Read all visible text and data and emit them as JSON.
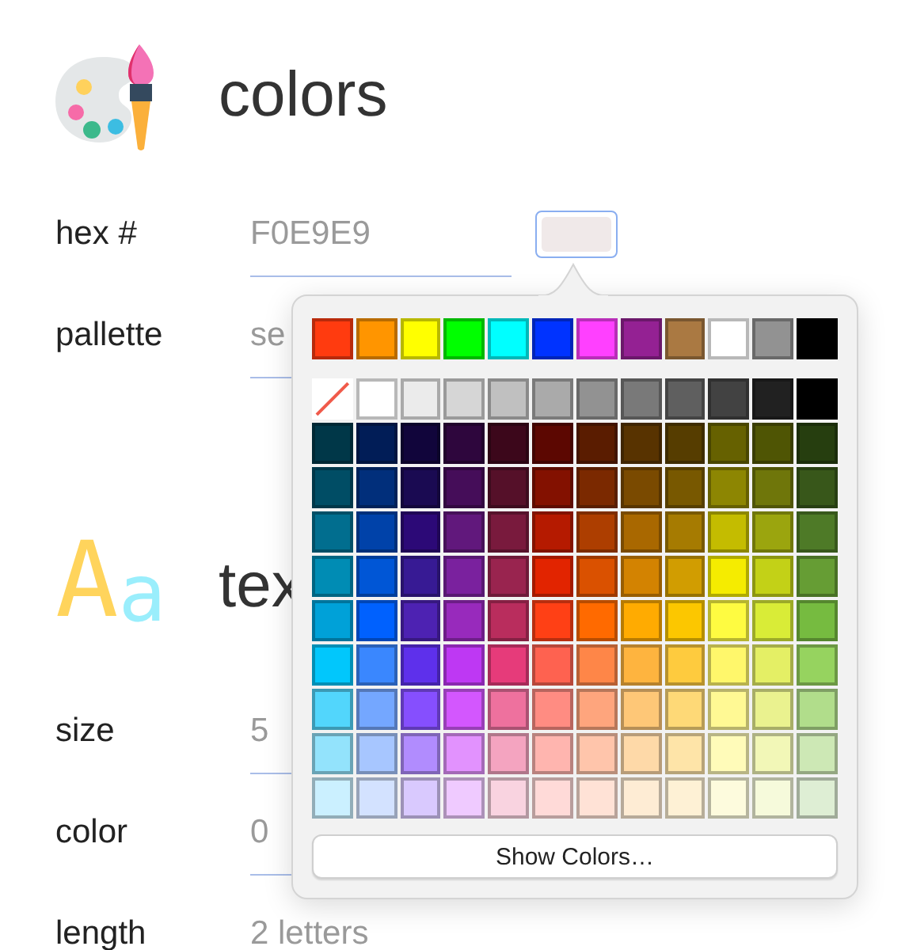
{
  "sections": [
    {
      "kind": "palette",
      "title": "colors",
      "fields": [
        {
          "label": "hex #",
          "value": "F0E9E9",
          "color_well": {
            "color": "#f0e9e9",
            "selected": true
          }
        },
        {
          "label": "pallette",
          "value": "se"
        }
      ]
    },
    {
      "kind": "letters",
      "title": "tex",
      "glyphs": [
        {
          "char": "A",
          "color": "#ffd45c"
        },
        {
          "char": "a",
          "color": "#9aeefc"
        }
      ],
      "fields": [
        {
          "label": "size",
          "value": "5"
        },
        {
          "label": "color",
          "value": "0"
        },
        {
          "label": "length",
          "value": "2 letters"
        }
      ]
    }
  ],
  "popover": {
    "top_colors": [
      {
        "color": "#ff3b0f"
      },
      {
        "color": "#ff9500"
      },
      {
        "color": "#ffff00"
      },
      {
        "color": "#00ff00"
      },
      {
        "color": "#00ffff"
      },
      {
        "color": "#0033ff"
      },
      {
        "color": "#ff40ff"
      },
      {
        "color": "#942193"
      },
      {
        "color": "#aa7942"
      },
      {
        "color": "#ffffff"
      },
      {
        "color": "#929292"
      },
      {
        "color": "#000000"
      }
    ],
    "gray_row": [
      {
        "kind": "none"
      },
      {
        "kind": "swatch",
        "color": "#ffffff"
      },
      {
        "kind": "swatch",
        "color": "#ebebeb"
      },
      {
        "kind": "swatch",
        "color": "#d6d6d6"
      },
      {
        "kind": "swatch",
        "color": "#c0c0c0"
      },
      {
        "kind": "swatch",
        "color": "#aaaaaa"
      },
      {
        "kind": "swatch",
        "color": "#929292"
      },
      {
        "kind": "swatch",
        "color": "#797979"
      },
      {
        "kind": "swatch",
        "color": "#5f5f5f"
      },
      {
        "kind": "swatch",
        "color": "#424242"
      },
      {
        "kind": "swatch",
        "color": "#212121"
      },
      {
        "kind": "swatch",
        "color": "#000000"
      }
    ],
    "grid": [
      {
        "swatches": [
          {
            "color": "#003748"
          },
          {
            "color": "#011d57"
          },
          {
            "color": "#11053b"
          },
          {
            "color": "#2e063d"
          },
          {
            "color": "#3c071b"
          },
          {
            "color": "#5c0701"
          },
          {
            "color": "#5a1c00"
          },
          {
            "color": "#583300"
          },
          {
            "color": "#563d00"
          },
          {
            "color": "#666100"
          },
          {
            "color": "#4f5504"
          },
          {
            "color": "#263e0f"
          }
        ]
      },
      {
        "swatches": [
          {
            "color": "#004d65"
          },
          {
            "color": "#012f7b"
          },
          {
            "color": "#1a0a52"
          },
          {
            "color": "#450d59"
          },
          {
            "color": "#551029"
          },
          {
            "color": "#831100"
          },
          {
            "color": "#7b2900"
          },
          {
            "color": "#7a4a00"
          },
          {
            "color": "#785800"
          },
          {
            "color": "#8d8602"
          },
          {
            "color": "#6f760a"
          },
          {
            "color": "#38571a"
          }
        ]
      },
      {
        "swatches": [
          {
            "color": "#016e8f"
          },
          {
            "color": "#0042a9"
          },
          {
            "color": "#2c0977"
          },
          {
            "color": "#61187c"
          },
          {
            "color": "#791a3d"
          },
          {
            "color": "#b51a00"
          },
          {
            "color": "#ad3e00"
          },
          {
            "color": "#a96800"
          },
          {
            "color": "#a67b01"
          },
          {
            "color": "#c4bc00"
          },
          {
            "color": "#9ba50e"
          },
          {
            "color": "#4e7a27"
          }
        ]
      },
      {
        "swatches": [
          {
            "color": "#008cb4"
          },
          {
            "color": "#0056d6"
          },
          {
            "color": "#371a94"
          },
          {
            "color": "#7a219e"
          },
          {
            "color": "#99244f"
          },
          {
            "color": "#e22400"
          },
          {
            "color": "#da5100"
          },
          {
            "color": "#d38301"
          },
          {
            "color": "#d19d01"
          },
          {
            "color": "#f5ec00"
          },
          {
            "color": "#c3d117"
          },
          {
            "color": "#669d34"
          }
        ]
      },
      {
        "swatches": [
          {
            "color": "#00a1d8"
          },
          {
            "color": "#0061fe"
          },
          {
            "color": "#4d22b2"
          },
          {
            "color": "#982abc"
          },
          {
            "color": "#b92d5d"
          },
          {
            "color": "#ff4015"
          },
          {
            "color": "#ff6a00"
          },
          {
            "color": "#ffab01"
          },
          {
            "color": "#fcc700"
          },
          {
            "color": "#fefb41"
          },
          {
            "color": "#d9ec37"
          },
          {
            "color": "#76bb40"
          }
        ]
      },
      {
        "swatches": [
          {
            "color": "#01c7fc"
          },
          {
            "color": "#3a87fe"
          },
          {
            "color": "#5e30eb"
          },
          {
            "color": "#be38f3"
          },
          {
            "color": "#e63b7a"
          },
          {
            "color": "#fe6250"
          },
          {
            "color": "#fe8648"
          },
          {
            "color": "#feb43f"
          },
          {
            "color": "#fecb3e"
          },
          {
            "color": "#fff76b"
          },
          {
            "color": "#e4ef65"
          },
          {
            "color": "#96d35f"
          }
        ]
      },
      {
        "swatches": [
          {
            "color": "#52d6fc"
          },
          {
            "color": "#74a7ff"
          },
          {
            "color": "#864ffe"
          },
          {
            "color": "#d357fe"
          },
          {
            "color": "#ee719e"
          },
          {
            "color": "#ff8c82"
          },
          {
            "color": "#fea57d"
          },
          {
            "color": "#fec777"
          },
          {
            "color": "#fed977"
          },
          {
            "color": "#fff994"
          },
          {
            "color": "#eaf28f"
          },
          {
            "color": "#b1dd8b"
          }
        ]
      },
      {
        "swatches": [
          {
            "color": "#93e3fc"
          },
          {
            "color": "#a7c6ff"
          },
          {
            "color": "#b18cfe"
          },
          {
            "color": "#e292fe"
          },
          {
            "color": "#f4a4c0"
          },
          {
            "color": "#ffb5af"
          },
          {
            "color": "#ffc5ab"
          },
          {
            "color": "#fed9a8"
          },
          {
            "color": "#fee4a8"
          },
          {
            "color": "#fffbb9"
          },
          {
            "color": "#f2f7b7"
          },
          {
            "color": "#cde8b5"
          }
        ]
      },
      {
        "swatches": [
          {
            "color": "#cbf0ff"
          },
          {
            "color": "#d3e2ff"
          },
          {
            "color": "#d9c9fe"
          },
          {
            "color": "#efcaff"
          },
          {
            "color": "#f9d3e0"
          },
          {
            "color": "#ffdad8"
          },
          {
            "color": "#ffe2d6"
          },
          {
            "color": "#feecd4"
          },
          {
            "color": "#fef1d5"
          },
          {
            "color": "#fdfbdd"
          },
          {
            "color": "#f6fadb"
          },
          {
            "color": "#deeed4"
          }
        ]
      }
    ],
    "button": "Show Colors…"
  }
}
